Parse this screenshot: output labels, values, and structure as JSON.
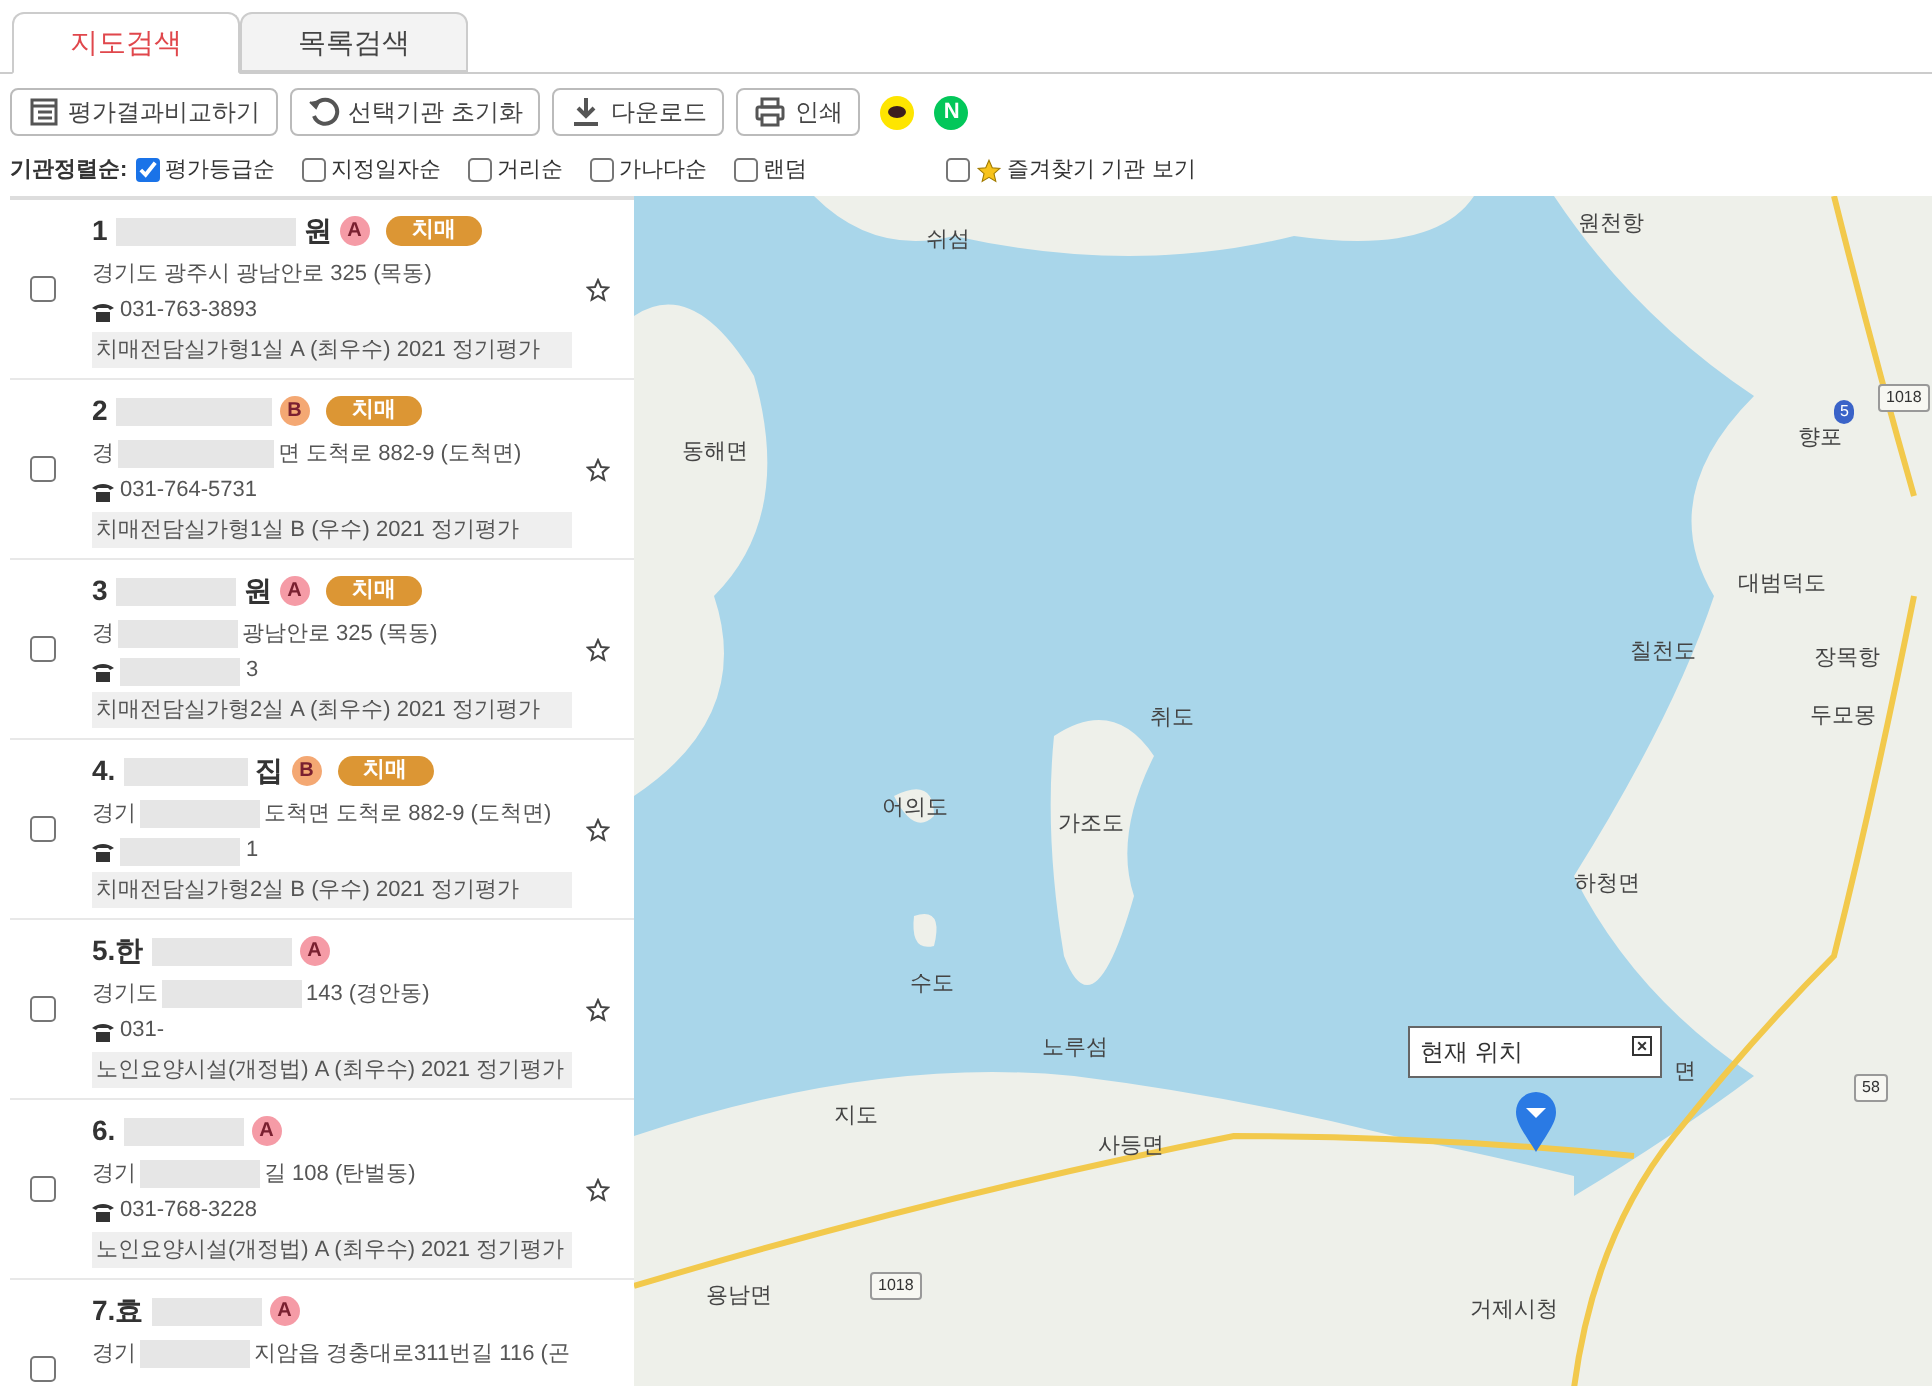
{
  "tabs": [
    {
      "label": "지도검색",
      "selected": true
    },
    {
      "label": "목록검색",
      "selected": false
    }
  ],
  "toolbar": [
    {
      "label": "평가결과비교하기"
    },
    {
      "label": "선택기관 초기화"
    },
    {
      "label": "다운로드"
    },
    {
      "label": "인쇄"
    }
  ],
  "share": [
    {
      "kind": "chat"
    },
    {
      "kind": "letter",
      "label": "N"
    }
  ],
  "sort": {
    "label": "기관정렬순:",
    "options": [
      {
        "label": "평가등급순",
        "checked": true
      },
      {
        "label": "지정일자순",
        "checked": false
      },
      {
        "label": "거리순",
        "checked": false
      },
      {
        "label": "가나다순",
        "checked": false
      },
      {
        "label": "랜덤",
        "checked": false
      }
    ],
    "favorites": {
      "label": "즐겨찾기 기관 보기",
      "checked": false
    }
  },
  "results": [
    {
      "name_head": "1",
      "name_tail": "원",
      "grade": "A",
      "tag": "치매",
      "address_head": "경기도 광주시 광남안로 325 (목동)",
      "phone_head": "031-763-3893",
      "evaluation": "치매전담실가형1실 A (최우수) 2021 정기평가",
      "checked": false,
      "favorite": false
    },
    {
      "name_head": "2",
      "grade": "B",
      "tag": "치매",
      "address_head": "경",
      "address_tail": "면 도척로 882-9 (도척면)",
      "phone_head": "031-764-5731",
      "evaluation": "치매전담실가형1실 B (우수) 2021 정기평가",
      "checked": false,
      "favorite": false
    },
    {
      "name_head": "3",
      "name_tail": "원",
      "grade": "A",
      "tag": "치매",
      "address_head": "경",
      "address_tail": "광남안로 325 (목동)",
      "phone_tail": "3",
      "evaluation": "치매전담실가형2실 A (최우수) 2021 정기평가",
      "checked": false,
      "favorite": false
    },
    {
      "name_head": "4.",
      "name_tail": "집",
      "grade": "B",
      "tag": "치매",
      "address_head": "경기",
      "address_tail": "도척면 도척로 882-9 (도척면)",
      "phone_tail": "1",
      "evaluation": "치매전담실가형2실 B (우수) 2021 정기평가",
      "checked": false,
      "favorite": false
    },
    {
      "name_head": "5.한",
      "grade": "A",
      "address_head": "경기도",
      "address_tail": "143 (경안동)",
      "phone_head": "031-",
      "evaluation": "노인요양시설(개정법) A (최우수) 2021 정기평가",
      "checked": false,
      "favorite": false
    },
    {
      "name_head": "6.",
      "grade": "A",
      "address_head": "경기",
      "address_tail": "길 108 (탄벌동)",
      "phone_head": "031-768-3228",
      "evaluation": "노인요양시설(개정법) A (최우수) 2021 정기평가",
      "checked": false,
      "favorite": false
    },
    {
      "name_head": "7.효",
      "grade": "A",
      "address_head": "경기",
      "address_tail": "지암읍 경충대로311번길 116 (곤",
      "checked": false
    }
  ],
  "map": {
    "places": [
      {
        "kind": "place",
        "label": "쉬섬"
      },
      {
        "kind": "place",
        "label": "원천항"
      },
      {
        "kind": "place",
        "label": "동해면"
      },
      {
        "kind": "place",
        "label": "향포"
      },
      {
        "kind": "place",
        "label": "대범덕도"
      },
      {
        "kind": "place",
        "label": "장목항"
      },
      {
        "kind": "place",
        "label": "칠천도"
      },
      {
        "kind": "place",
        "label": "두모몽"
      },
      {
        "kind": "place",
        "label": "취도"
      },
      {
        "kind": "place",
        "label": "어의도"
      },
      {
        "kind": "place",
        "label": "가조도"
      },
      {
        "kind": "place",
        "label": "하청면"
      },
      {
        "kind": "place",
        "label": "수도"
      },
      {
        "kind": "place",
        "label": "노루섬"
      },
      {
        "kind": "place",
        "label": "지도"
      },
      {
        "kind": "place",
        "label": "사등면"
      },
      {
        "kind": "place",
        "label": "용남면"
      },
      {
        "kind": "place",
        "label": "거제시청"
      },
      {
        "kind": "place",
        "label": "면"
      },
      {
        "kind": "road",
        "label": "1018"
      },
      {
        "kind": "road",
        "label": "58"
      },
      {
        "kind": "road",
        "label": "5"
      },
      {
        "kind": "road",
        "label": "1018"
      }
    ],
    "popup": {
      "label": "현재 위치",
      "close": "×"
    }
  }
}
